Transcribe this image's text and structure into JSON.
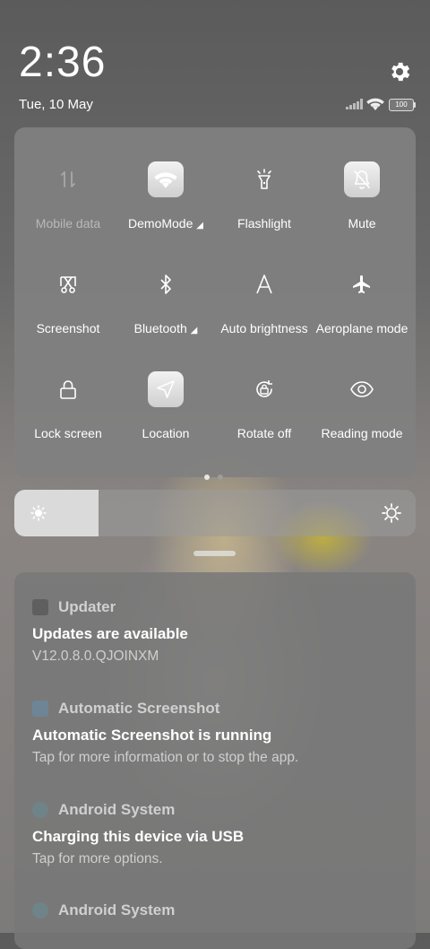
{
  "status_bar": {
    "time": "2:36",
    "date": "Tue, 10 May",
    "battery_level": "100"
  },
  "quick_settings": {
    "tiles": [
      {
        "label": "Mobile data",
        "icon": "mobile-data-icon",
        "state": "disabled"
      },
      {
        "label": "DemoMode",
        "icon": "wifi-icon",
        "state": "on",
        "expandable": true
      },
      {
        "label": "Flashlight",
        "icon": "flashlight-icon",
        "state": "off"
      },
      {
        "label": "Mute",
        "icon": "bell-off-icon",
        "state": "on"
      },
      {
        "label": "Screenshot",
        "icon": "screenshot-icon",
        "state": "off"
      },
      {
        "label": "Bluetooth",
        "icon": "bluetooth-icon",
        "state": "off",
        "expandable": true
      },
      {
        "label": "Auto brightness",
        "icon": "auto-brightness-icon",
        "state": "off"
      },
      {
        "label": "Aeroplane mode",
        "icon": "airplane-icon",
        "state": "off"
      },
      {
        "label": "Lock screen",
        "icon": "lock-icon",
        "state": "off"
      },
      {
        "label": "Location",
        "icon": "location-icon",
        "state": "on"
      },
      {
        "label": "Rotate off",
        "icon": "rotate-lock-icon",
        "state": "off"
      },
      {
        "label": "Reading mode",
        "icon": "eye-icon",
        "state": "off"
      }
    ],
    "page_count": 2,
    "current_page": 1
  },
  "brightness": {
    "level": 0.21
  },
  "notifications": [
    {
      "app": "Updater",
      "title": "Updates are available",
      "text": "V12.0.8.0.QJOINXM",
      "icon_color": "#5f5f5f"
    },
    {
      "app": "Automatic Screenshot",
      "title": "Automatic Screenshot is running",
      "text": "Tap for more information or to stop the app.",
      "icon_color": "#6e8596"
    },
    {
      "app": "Android System",
      "title": "Charging this device via USB",
      "text": "Tap for more options.",
      "icon_color": "#6f8488"
    },
    {
      "app": "Android System",
      "title": "",
      "text": "",
      "icon_color": "#6f8488"
    }
  ],
  "colors": {
    "panel": "#808080",
    "tile_on": "#e6e6e6"
  }
}
